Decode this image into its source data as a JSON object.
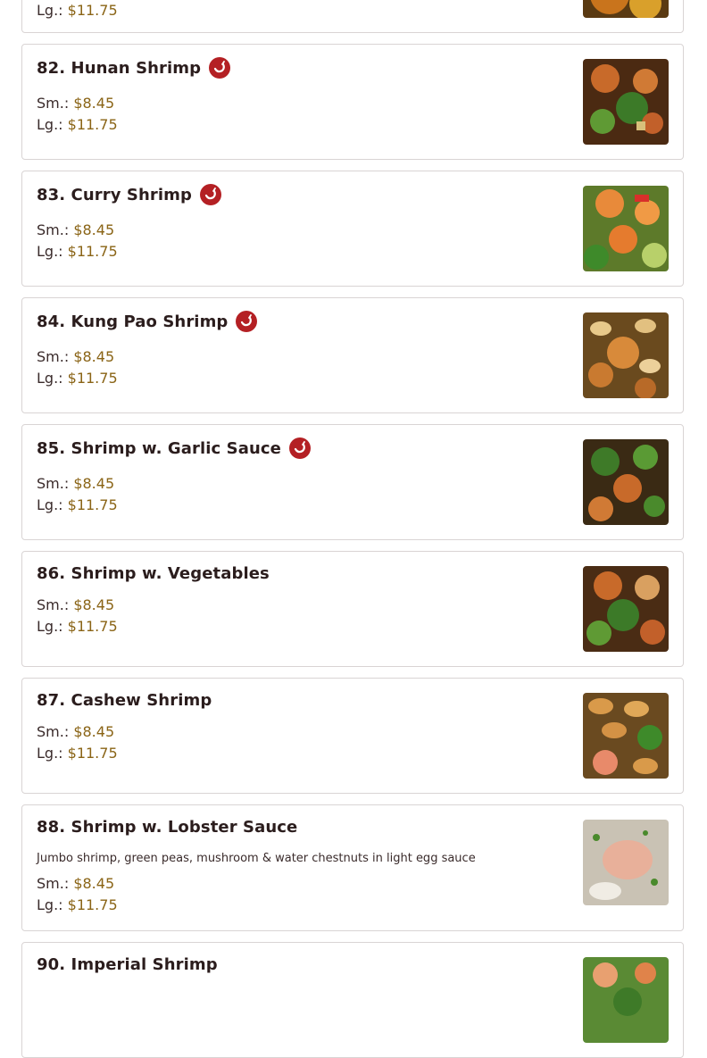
{
  "price_labels": {
    "small": "Sm.:",
    "large": "Lg.:"
  },
  "partial_top": {
    "large_label": "Lg.:",
    "large_price": "$11.75"
  },
  "items": [
    {
      "number_name": "82. Hunan Shrimp",
      "spicy": true,
      "description": "",
      "small_price": "$8.45",
      "large_price": "$11.75",
      "image": "hunan-shrimp-photo"
    },
    {
      "number_name": "83. Curry Shrimp",
      "spicy": true,
      "description": "",
      "small_price": "$8.45",
      "large_price": "$11.75",
      "image": "curry-shrimp-photo"
    },
    {
      "number_name": "84. Kung Pao Shrimp",
      "spicy": true,
      "description": "",
      "small_price": "$8.45",
      "large_price": "$11.75",
      "image": "kung-pao-shrimp-photo"
    },
    {
      "number_name": "85. Shrimp w. Garlic Sauce",
      "spicy": true,
      "description": "",
      "small_price": "$8.45",
      "large_price": "$11.75",
      "image": "garlic-shrimp-photo"
    },
    {
      "number_name": "86. Shrimp w. Vegetables",
      "spicy": false,
      "description": "",
      "small_price": "$8.45",
      "large_price": "$11.75",
      "image": "shrimp-vegetables-photo"
    },
    {
      "number_name": "87. Cashew Shrimp",
      "spicy": false,
      "description": "",
      "small_price": "$8.45",
      "large_price": "$11.75",
      "image": "cashew-shrimp-photo"
    },
    {
      "number_name": "88. Shrimp w. Lobster Sauce",
      "spicy": false,
      "description": "Jumbo shrimp, green peas, mushroom & water chestnuts in light egg sauce",
      "small_price": "$8.45",
      "large_price": "$11.75",
      "image": "lobster-sauce-shrimp-photo"
    },
    {
      "number_name": "90. Imperial Shrimp",
      "spicy": false,
      "description": "",
      "small_price": "",
      "large_price": "",
      "image": "imperial-shrimp-photo"
    }
  ],
  "colors": {
    "spicy_badge": "#b42024",
    "price": "#8a6416",
    "border": "#d9d4d4"
  }
}
